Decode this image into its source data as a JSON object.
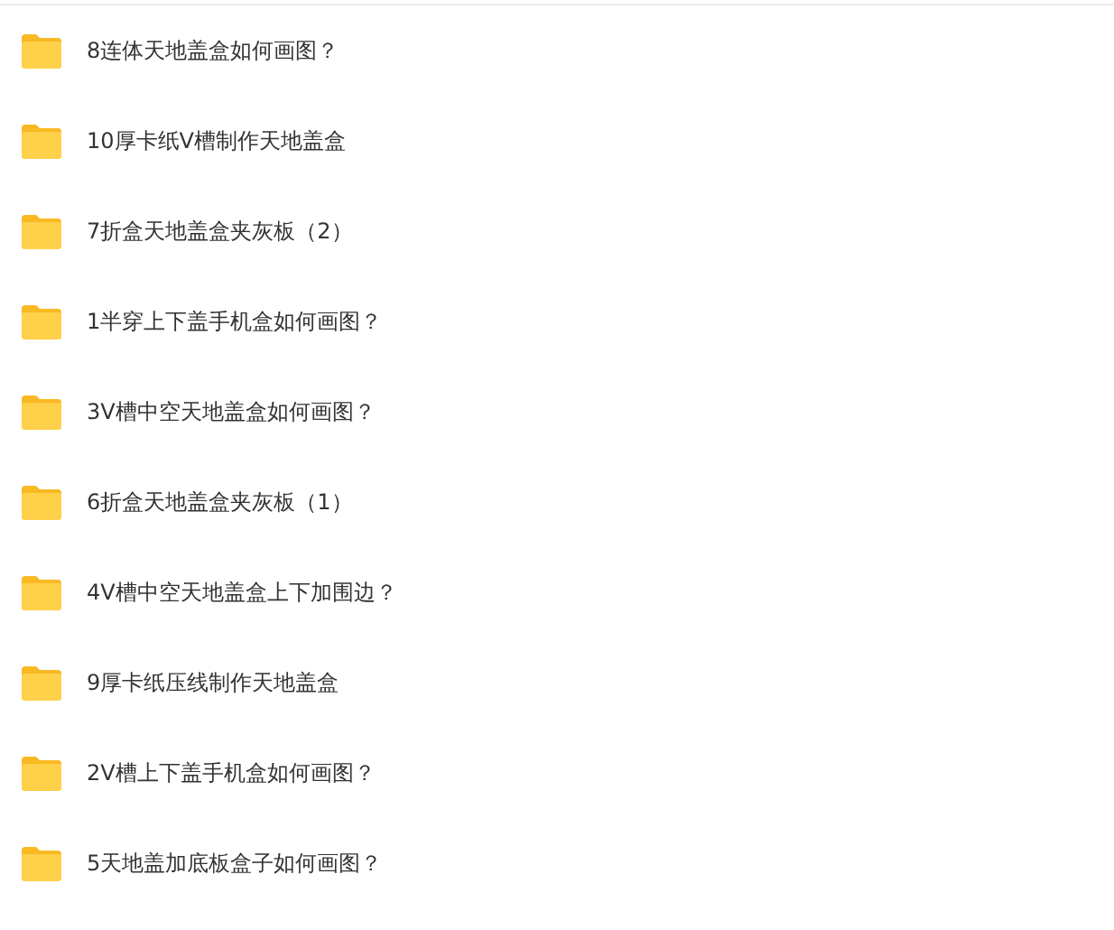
{
  "folders": [
    {
      "name": "8连体天地盖盒如何画图？"
    },
    {
      "name": "10厚卡纸V槽制作天地盖盒"
    },
    {
      "name": "7折盒天地盖盒夹灰板（2）"
    },
    {
      "name": "1半穿上下盖手机盒如何画图？"
    },
    {
      "name": "3V槽中空天地盖盒如何画图？"
    },
    {
      "name": "6折盒天地盖盒夹灰板（1）"
    },
    {
      "name": "4V槽中空天地盖盒上下加围边？"
    },
    {
      "name": "9厚卡纸压线制作天地盖盒"
    },
    {
      "name": "2V槽上下盖手机盒如何画图？"
    },
    {
      "name": "5天地盖加底板盒子如何画图？"
    }
  ]
}
